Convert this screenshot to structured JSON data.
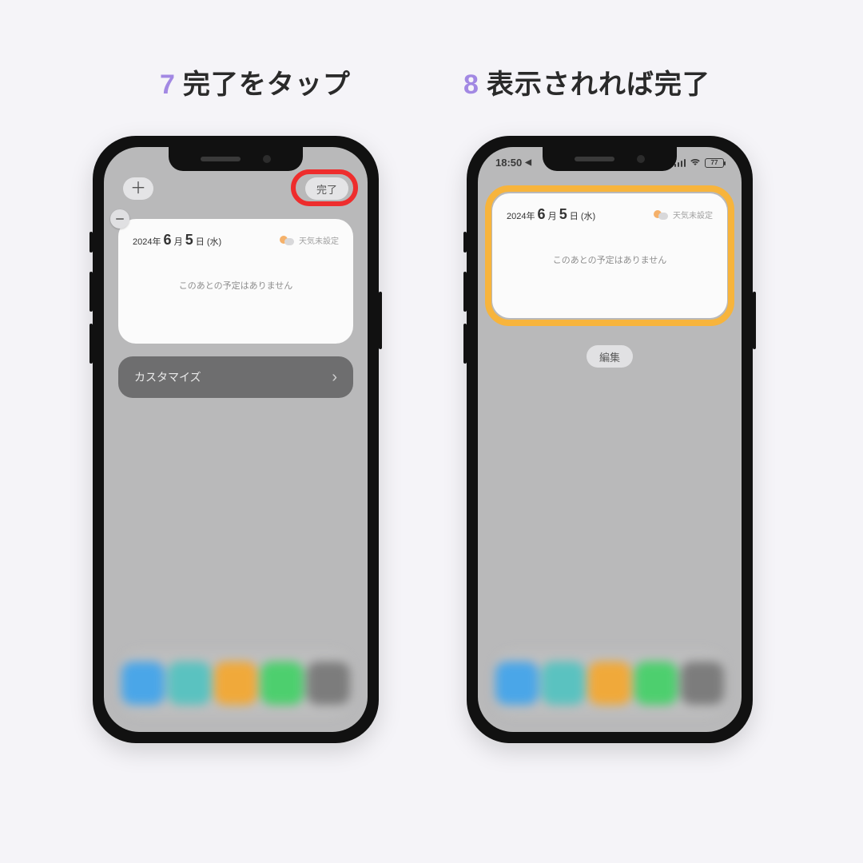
{
  "steps": {
    "left": {
      "num": "7",
      "text": "完了をタップ"
    },
    "right": {
      "num": "8",
      "text": "表示されれば完了"
    }
  },
  "left_phone": {
    "add_label": "＋",
    "done_label": "完了",
    "widget": {
      "date_prefix": "2024年",
      "month": "6",
      "month_suffix": "月",
      "day": "5",
      "day_suffix": "日 (水)",
      "weather_label": "天気未設定",
      "body": "このあとの予定はありません"
    },
    "customize_label": "カスタマイズ"
  },
  "right_phone": {
    "status": {
      "time": "18:50",
      "battery": "77"
    },
    "widget": {
      "date_prefix": "2024年",
      "month": "6",
      "month_suffix": "月",
      "day": "5",
      "day_suffix": "日 (水)",
      "weather_label": "天気未設定",
      "body": "このあとの予定はありません"
    },
    "edit_label": "編集"
  },
  "dock_colors": [
    "#4aa6e8",
    "#5ac2c0",
    "#f0a93a",
    "#4dcf6e",
    "#7c7c7c"
  ]
}
